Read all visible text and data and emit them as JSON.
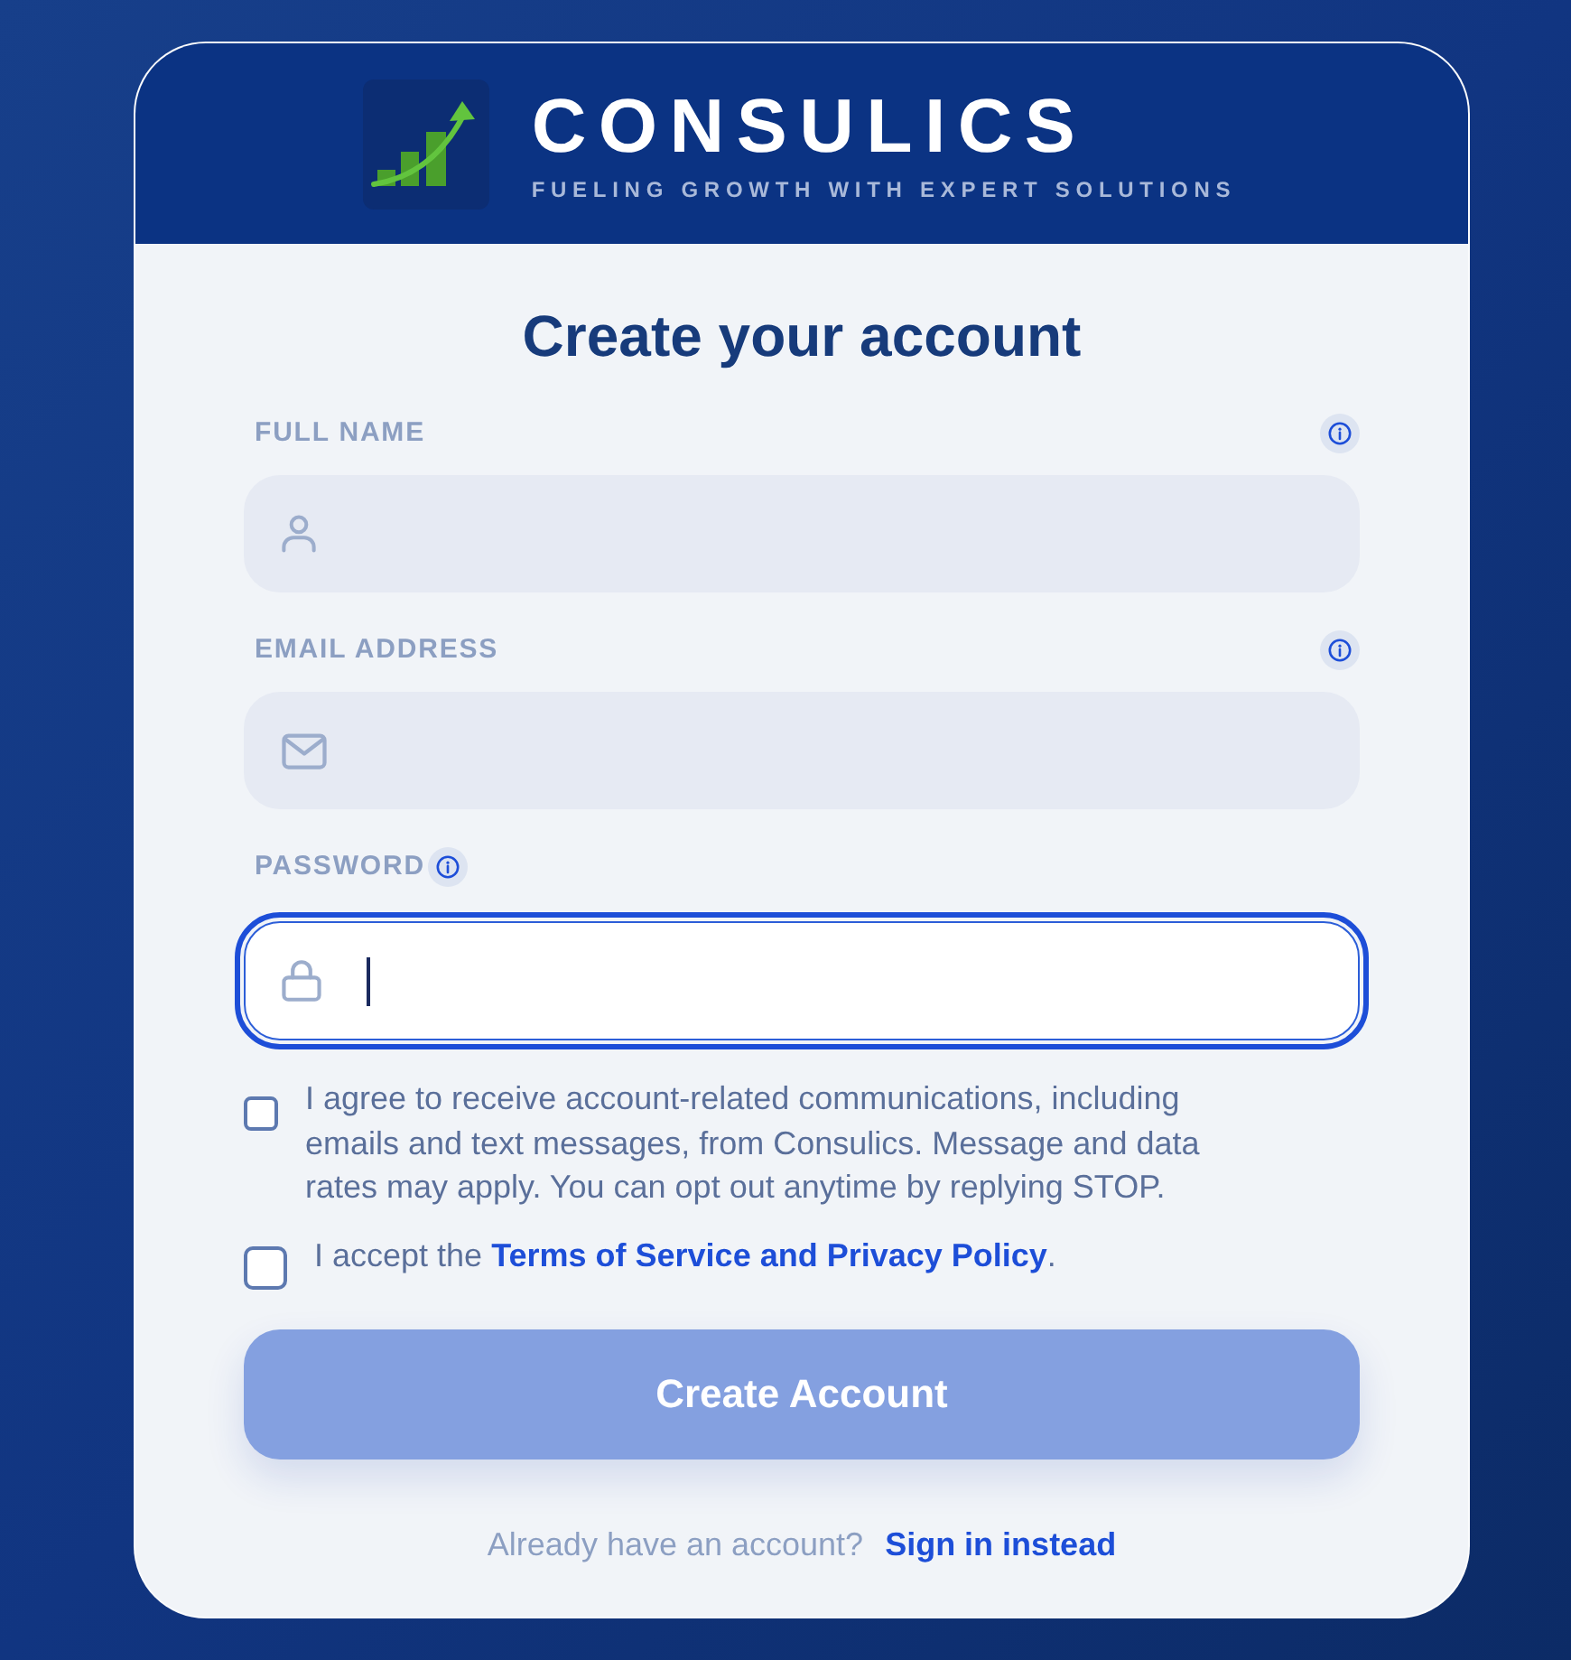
{
  "brand": {
    "name": "CONSULICS",
    "tagline": "FUELING GROWTH WITH EXPERT SOLUTIONS"
  },
  "title": "Create your account",
  "fields": [
    {
      "kind": "name",
      "label": "FULL NAME",
      "focused": false
    },
    {
      "kind": "email",
      "label": "EMAIL ADDRESS",
      "focused": false
    },
    {
      "kind": "password",
      "label": "PASSWORD",
      "focused": true
    }
  ],
  "consents": [
    {
      "kind": "plain",
      "text": "I agree to receive account-related communications, including emails and text messages, from Consulics. Message and data rates may apply. You can opt out anytime by replying STOP.",
      "checked": false
    },
    {
      "kind": "link",
      "text": "I accept the",
      "link": "Terms of Service and Privacy Policy",
      "after": ".",
      "checked": false
    }
  ],
  "submit": {
    "label": "Create Account",
    "disabled": true
  },
  "footer": {
    "prompt": "Already have an account?",
    "link": "Sign in instead"
  }
}
